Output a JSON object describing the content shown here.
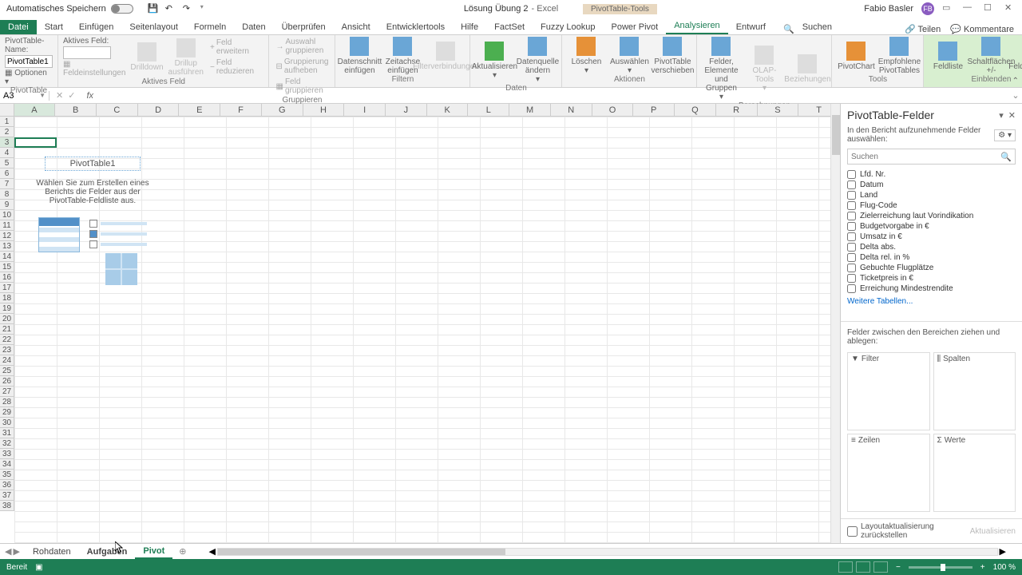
{
  "titlebar": {
    "autosave": "Automatisches Speichern",
    "doc_name": "Lösung Übung 2",
    "app_name": "Excel",
    "tool_context": "PivotTable-Tools",
    "user_name": "Fabio Basler",
    "user_initials": "FB"
  },
  "ribbon": {
    "tabs": [
      "Datei",
      "Start",
      "Einfügen",
      "Seitenlayout",
      "Formeln",
      "Daten",
      "Überprüfen",
      "Ansicht",
      "Entwicklertools",
      "Hilfe",
      "FactSet",
      "Fuzzy Lookup",
      "Power Pivot",
      "Analysieren",
      "Entwurf"
    ],
    "active_tab": "Analysieren",
    "search_label": "Suchen",
    "share": "Teilen",
    "comments": "Kommentare",
    "groups": {
      "pivottable": {
        "name_label": "PivotTable-Name:",
        "name_value": "PivotTable1",
        "options": "Optionen",
        "label": "PivotTable"
      },
      "active_field": {
        "field_label": "Aktives Feld:",
        "drilldown": "Drilldown",
        "drillup": "Drillup ausführen",
        "settings": "Feldeinstellungen",
        "expand": "Feld erweitern",
        "collapse": "Feld reduzieren",
        "label": "Aktives Feld"
      },
      "group": {
        "sel": "Auswahl gruppieren",
        "ungroup": "Gruppierung aufheben",
        "field": "Feld gruppieren",
        "label": "Gruppieren"
      },
      "filter": {
        "slicer": "Datenschnitt einfügen",
        "timeline": "Zeitachse einfügen",
        "connections": "Filterverbindungen",
        "label": "Filtern"
      },
      "data": {
        "refresh": "Aktualisieren",
        "change_source": "Datenquelle ändern",
        "label": "Daten"
      },
      "actions": {
        "clear": "Löschen",
        "select": "Auswählen",
        "move": "PivotTable verschieben",
        "label": "Aktionen"
      },
      "calc": {
        "fields": "Felder, Elemente und Gruppen",
        "olap": "OLAP-Tools",
        "relations": "Beziehungen",
        "label": "Berechnungen"
      },
      "tools": {
        "chart": "PivotChart",
        "recommended": "Empfohlene PivotTables",
        "label": "Tools"
      },
      "show": {
        "fieldlist": "Feldliste",
        "buttons": "Schaltflächen +/-",
        "headers": "Feldkopfzeilen",
        "label": "Einblenden"
      }
    }
  },
  "namebox": "A3",
  "columns": [
    "A",
    "B",
    "C",
    "D",
    "E",
    "F",
    "G",
    "H",
    "I",
    "J",
    "K",
    "L",
    "M",
    "N",
    "O",
    "P",
    "Q",
    "R",
    "S",
    "T"
  ],
  "pivot_placeholder": {
    "title": "PivotTable1",
    "hint": "Wählen Sie zum Erstellen eines Berichts die Felder aus der PivotTable-Feldliste aus."
  },
  "taskpane": {
    "title": "PivotTable-Felder",
    "subtitle": "In den Bericht aufzunehmende Felder auswählen:",
    "search_placeholder": "Suchen",
    "fields": [
      "Lfd. Nr.",
      "Datum",
      "Land",
      "Flug-Code",
      "Zielerreichung laut Vorindikation",
      "Budgetvorgabe in €",
      "Umsatz in €",
      "Delta abs.",
      "Delta rel. in %",
      "Gebuchte Flugplätze",
      "Ticketpreis in €",
      "Erreichung Mindestrendite"
    ],
    "more_tables": "Weitere Tabellen...",
    "areas_label": "Felder zwischen den Bereichen ziehen und ablegen:",
    "area_filter": "Filter",
    "area_columns": "Spalten",
    "area_rows": "Zeilen",
    "area_values": "Werte",
    "defer": "Layoutaktualisierung zurückstellen",
    "update": "Aktualisieren"
  },
  "sheets": {
    "tabs": [
      "Rohdaten",
      "Aufgaben",
      "Pivot"
    ],
    "active": "Pivot"
  },
  "statusbar": {
    "status": "Bereit",
    "zoom": "100 %"
  }
}
